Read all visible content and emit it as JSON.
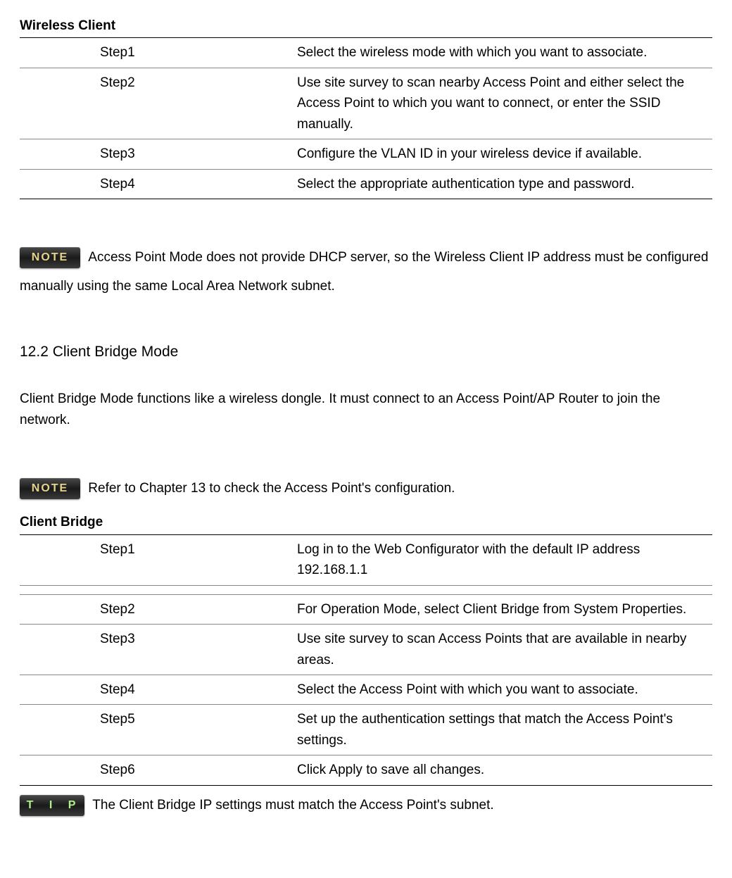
{
  "badges": {
    "note": "NOTE",
    "tip": "T I P"
  },
  "wirelessClient": {
    "title": "Wireless Client",
    "steps": [
      {
        "label": "Step1",
        "desc": "Select the wireless mode with which you want to associate."
      },
      {
        "label": "Step2",
        "desc": "Use site survey to scan nearby Access Point and either select the Access Point to which you want to connect, or enter the SSID manually."
      },
      {
        "label": "Step3",
        "desc": "Configure the VLAN ID in your wireless device if available."
      },
      {
        "label": "Step4",
        "desc": "Select the appropriate authentication type and password."
      }
    ]
  },
  "note1": "Access Point Mode does not provide DHCP server, so the Wireless Client IP address must be configured manually using the same Local Area Network subnet.",
  "section": {
    "heading": "12.2 Client Bridge Mode",
    "intro": "Client Bridge Mode functions like a wireless dongle. It must connect to an Access Point/AP Router to join the network."
  },
  "note2": "Refer to Chapter 13 to check the Access Point's configuration.",
  "clientBridge": {
    "title": "Client Bridge",
    "steps": [
      {
        "label": "Step1",
        "desc": "Log in to the Web Configurator with the default IP address 192.168.1.1"
      },
      {
        "label": "Step2",
        "desc": "For Operation Mode, select Client Bridge from System Properties."
      },
      {
        "label": "Step3",
        "desc": "Use site survey to scan Access Points that are available in nearby areas."
      },
      {
        "label": "Step4",
        "desc": "Select the Access Point with which you want to associate."
      },
      {
        "label": "Step5",
        "desc": "Set up the authentication settings that match the Access Point's settings."
      },
      {
        "label": "Step6",
        "desc": "Click Apply to save all changes."
      }
    ]
  },
  "tip1": "The Client Bridge IP settings must match the Access Point's subnet."
}
